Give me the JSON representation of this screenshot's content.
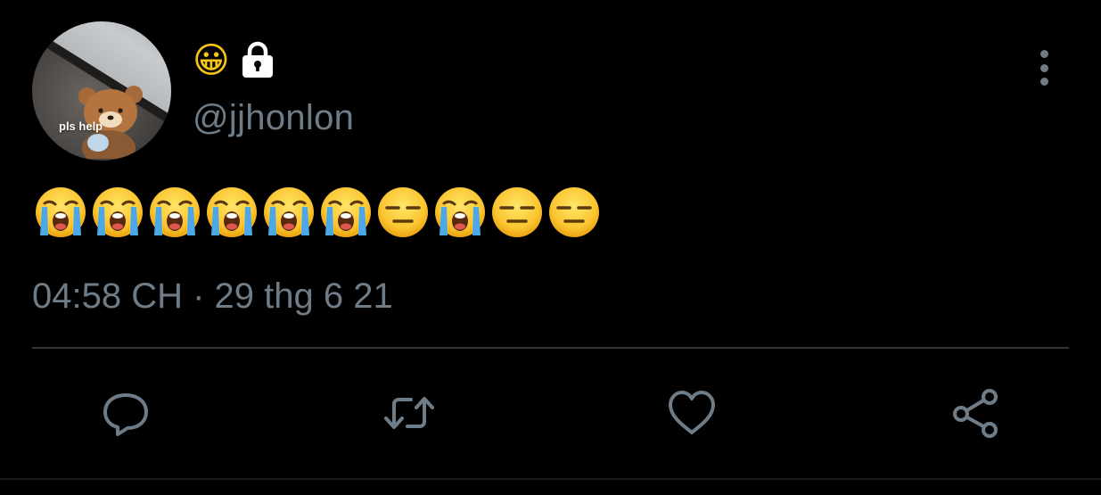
{
  "tweet": {
    "avatar_caption": "pls help",
    "display_name_emoji": "😀",
    "handle": "@jjhonlon",
    "body_emojis": [
      "sob",
      "sob",
      "sob",
      "sob",
      "sob",
      "sob",
      "expressionless",
      "sob",
      "expressionless",
      "expressionless"
    ],
    "timestamp": "04:58 CH · 29 thg 6 21"
  },
  "icons": {
    "lock": "lock-icon",
    "more": "vertical-ellipsis-icon",
    "reply": "reply-icon",
    "retweet": "retweet-icon",
    "like": "heart-icon",
    "share": "share-icon"
  },
  "colors": {
    "background": "#000000",
    "muted_text": "#6e7c88",
    "divider": "#2f3336"
  }
}
